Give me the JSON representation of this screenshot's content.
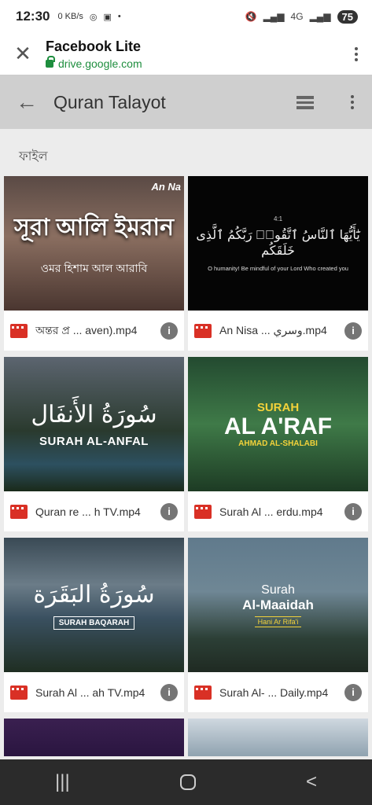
{
  "status": {
    "time": "12:30",
    "net_speed": "0 KB/s",
    "signal": "4G",
    "battery": "75"
  },
  "browser": {
    "title": "Facebook Lite",
    "url": "drive.google.com"
  },
  "app_bar": {
    "title": "Quran Talayot"
  },
  "section_label": "ফাইল",
  "files": [
    {
      "name": "অন্তর প্র ... aven).mp4",
      "thumb_title": "সূরা আলি ইমরান",
      "thumb_sub": "ওমর হিশাম আল আরাবি",
      "thumb_corner": "An Na"
    },
    {
      "name": "An Nisa ... وسري.mp4",
      "thumb_ref": "4:1",
      "thumb_arabic": "يَٰٓأَيُّهَا ٱلنَّاسُ ٱتَّقُوا۟ رَبَّكُمُ ٱلَّذِى خَلَقَكُم",
      "thumb_en": "O humanity! Be mindful of your Lord Who created you"
    },
    {
      "name": "Quran re ... h TV.mp4",
      "thumb_calig": "سُورَةُ الأَنفَال",
      "thumb_title": "SURAH AL-ANFAL"
    },
    {
      "name": "Surah Al ... erdu.mp4",
      "thumb_top": "SURAH",
      "thumb_title": "AL A'RAF",
      "thumb_sub": "AHMAD AL-SHALABI"
    },
    {
      "name": "Surah Al ... ah TV.mp4",
      "thumb_calig": "سُورَةُ البَقَرَة",
      "thumb_title": "SURAH BAQARAH"
    },
    {
      "name": "Surah Al- ... Daily.mp4",
      "thumb_top": "Surah",
      "thumb_title": "Al-Maaidah",
      "thumb_sub": "Hani Ar Rifa'i"
    }
  ],
  "nav": {
    "recents": "|||",
    "back": "<"
  }
}
